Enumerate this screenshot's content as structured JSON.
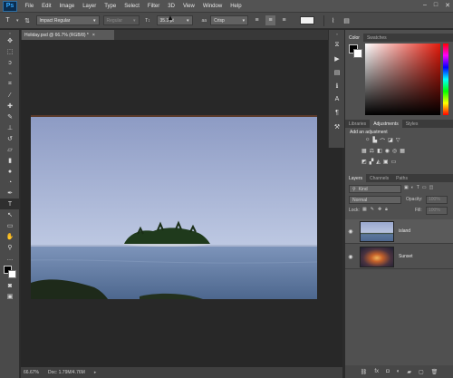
{
  "menu": [
    "File",
    "Edit",
    "Image",
    "Layer",
    "Type",
    "Select",
    "Filter",
    "3D",
    "View",
    "Window",
    "Help"
  ],
  "app_logo": "Ps",
  "window_controls": [
    "–",
    "□",
    "✕"
  ],
  "options": {
    "tool_icon": "T",
    "font_family": "Impact Regular",
    "font_style": "Regular",
    "font_size": "35.3 pt",
    "antialias_label": "aa",
    "antialias": "Crisp"
  },
  "document": {
    "tab_title": "Holiday.psd @ 66.7% (RGB/8) *",
    "tab_close": "×"
  },
  "status": {
    "zoom": "66.67%",
    "doc": "Doc: 1.79M/4.76M"
  },
  "panels": {
    "color_tabs": [
      "Color",
      "Swatches"
    ],
    "adjust_tabs": [
      "Libraries",
      "Adjustments",
      "Styles"
    ],
    "adjust_heading": "Add an adjustment",
    "layers_tabs": [
      "Layers",
      "Channels",
      "Paths"
    ],
    "kind": "Kind",
    "blend": "Normal",
    "opacity_label": "Opacity:",
    "opacity_value": "100%",
    "lock_label": "Lock:",
    "fill_label": "Fill:",
    "fill_value": "100%"
  },
  "layers": [
    {
      "name": "island"
    },
    {
      "name": "Sunset"
    }
  ],
  "colors": {
    "sky_top": "#8f9fc9",
    "sky_bottom": "#b9c6e2",
    "sea": "#5c7a9f",
    "panel_bg": "#505050"
  }
}
